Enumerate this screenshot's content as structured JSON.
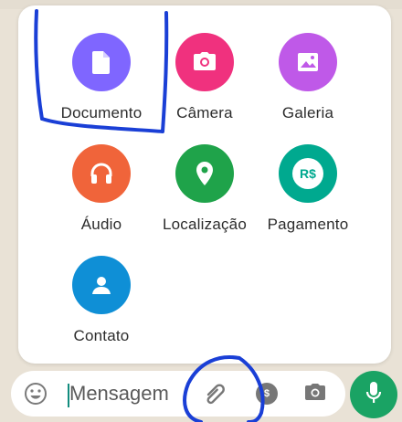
{
  "attach_menu": {
    "items": [
      {
        "label": "Documento",
        "icon": "document-icon",
        "color": "#7f66ff"
      },
      {
        "label": "Câmera",
        "icon": "camera-icon",
        "color": "#f0317e"
      },
      {
        "label": "Galeria",
        "icon": "gallery-icon",
        "color": "#bf59e8"
      },
      {
        "label": "Áudio",
        "icon": "headphones-icon",
        "color": "#f0643a"
      },
      {
        "label": "Localização",
        "icon": "location-pin-icon",
        "color": "#1fa34a"
      },
      {
        "label": "Pagamento",
        "icon": "payment-icon",
        "color": "#00a98f",
        "badge": "R$"
      },
      {
        "label": "Contato",
        "icon": "contact-icon",
        "color": "#0f8fd6"
      }
    ]
  },
  "composer": {
    "placeholder": "Mensagem",
    "icons": [
      "emoji-icon",
      "paperclip-icon",
      "payment-icon",
      "camera-icon"
    ],
    "send_button_icon": "microphone-icon",
    "mic_color": "#1aa364"
  },
  "annotation_color": "#1a3fd6"
}
